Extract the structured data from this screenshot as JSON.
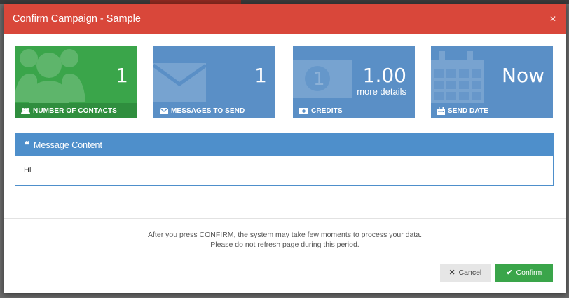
{
  "modal": {
    "title": "Confirm Campaign - Sample",
    "close_icon": "close-icon"
  },
  "tiles": [
    {
      "value": "1",
      "sub": "",
      "label": "NUMBER OF CONTACTS",
      "icon": "users-icon",
      "color": "#3aa54a"
    },
    {
      "value": "1",
      "sub": "",
      "label": "MESSAGES TO SEND",
      "icon": "envelope-icon",
      "color": "#5a8fc6"
    },
    {
      "value": "1.00",
      "sub": "more details",
      "label": "CREDITS",
      "icon": "money-icon",
      "color": "#5a8fc6"
    },
    {
      "value": "Now",
      "sub": "",
      "label": "SEND DATE",
      "icon": "calendar-icon",
      "color": "#5a8fc6"
    }
  ],
  "message_panel": {
    "title": "Message Content",
    "content": "Hi"
  },
  "notice": {
    "line1": "After you press CONFIRM, the system may take few moments to process your data.",
    "line2": "Please do not refresh page during this period."
  },
  "buttons": {
    "cancel": "Cancel",
    "confirm": "Confirm"
  },
  "colors": {
    "header": "#d9473a",
    "green": "#3aa54a",
    "blue": "#5a8fc6",
    "panel_blue": "#4e8fcb"
  }
}
